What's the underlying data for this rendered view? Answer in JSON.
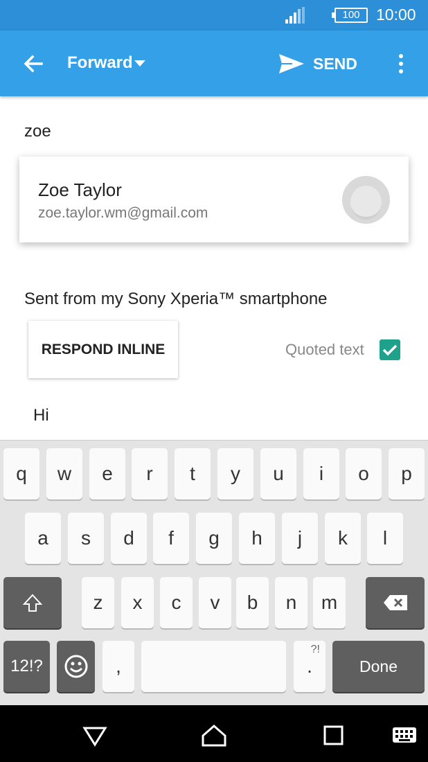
{
  "status_bar": {
    "battery": "100",
    "time": "10:00",
    "icons": [
      "signal-icon",
      "battery-icon"
    ]
  },
  "app_bar": {
    "back_icon": "arrow-left-icon",
    "mode_label": "Forward",
    "send_label": "SEND",
    "send_icon": "send-icon",
    "more_icon": "overflow-menu-icon"
  },
  "compose": {
    "to_text": "zoe",
    "suggestion": {
      "name": "Zoe Taylor",
      "email": "zoe.taylor.wm@gmail.com"
    },
    "signature": "Sent from my Sony Xperia™ smartphone",
    "respond_inline_label": "RESPOND INLINE",
    "quoted_text_label": "Quoted text",
    "quoted_text_checked": true,
    "body": "Hi"
  },
  "keyboard": {
    "row1": [
      "q",
      "w",
      "e",
      "r",
      "t",
      "y",
      "u",
      "i",
      "o",
      "p"
    ],
    "row2": [
      "a",
      "s",
      "d",
      "f",
      "g",
      "h",
      "j",
      "k",
      "l"
    ],
    "row3": [
      "z",
      "x",
      "c",
      "v",
      "b",
      "n",
      "m"
    ],
    "symbols_label": "12!?",
    "comma_label": ",",
    "period_label": ".",
    "period_alt": "?!",
    "done_label": "Done",
    "accent_color": "#5f5f5f"
  },
  "nav_bar": {
    "icons": [
      "back-triangle-icon",
      "home-icon",
      "recents-icon",
      "keyboard-icon"
    ]
  },
  "colors": {
    "status_bar": "#2c8fd7",
    "app_bar": "#33a0e8",
    "checkbox": "#1fa28b"
  }
}
